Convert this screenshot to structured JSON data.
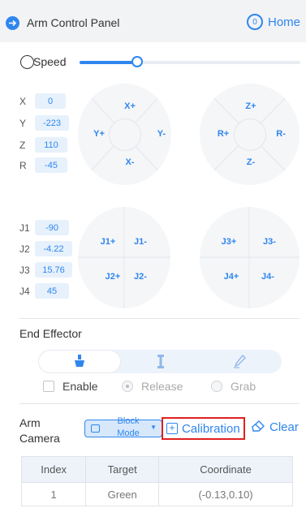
{
  "header": {
    "title": "Arm Control Panel",
    "home_label": "Home"
  },
  "speed": {
    "label": "Speed",
    "value_fraction": 0.26
  },
  "cartesian": {
    "rows": [
      {
        "axis": "X",
        "value": "0"
      },
      {
        "axis": "Y",
        "value": "-223"
      },
      {
        "axis": "Z",
        "value": "110"
      },
      {
        "axis": "R",
        "value": "-45"
      }
    ],
    "pad_xy": {
      "top": "X+",
      "left": "Y+",
      "right": "Y-",
      "bottom": "X-"
    },
    "pad_zr": {
      "top": "Z+",
      "left": "R+",
      "right": "R-",
      "bottom": "Z-"
    }
  },
  "joints": {
    "rows": [
      {
        "axis": "J1",
        "value": "-90"
      },
      {
        "axis": "J2",
        "value": "-4.22"
      },
      {
        "axis": "J3",
        "value": "15.76"
      },
      {
        "axis": "J4",
        "value": "45"
      }
    ],
    "pad_j12": {
      "tl": "J1+",
      "tr": "J1-",
      "bl": "J2+",
      "br": "J2-"
    },
    "pad_j34": {
      "tl": "J3+",
      "tr": "J3-",
      "bl": "J4+",
      "br": "J4-"
    }
  },
  "end_effector": {
    "title": "End Effector",
    "enable_label": "Enable",
    "release_label": "Release",
    "grab_label": "Grab",
    "icons": [
      "suction-cup-icon",
      "gripper-icon",
      "pen-icon"
    ]
  },
  "arm_camera": {
    "label_line1": "Arm",
    "label_line2": "Camera",
    "mode_line1": "Block",
    "mode_line2": "Mode",
    "calibration_label": "Calibration",
    "clear_label": "Clear"
  },
  "table": {
    "headers": [
      "Index",
      "Target",
      "Coordinate"
    ],
    "rows": [
      [
        "1",
        "Green",
        "(-0.13,0.10)"
      ]
    ]
  },
  "colors": {
    "accent": "#2f86ef",
    "highlight_border": "#e02020",
    "pad_bg": "#f5f6f8"
  }
}
